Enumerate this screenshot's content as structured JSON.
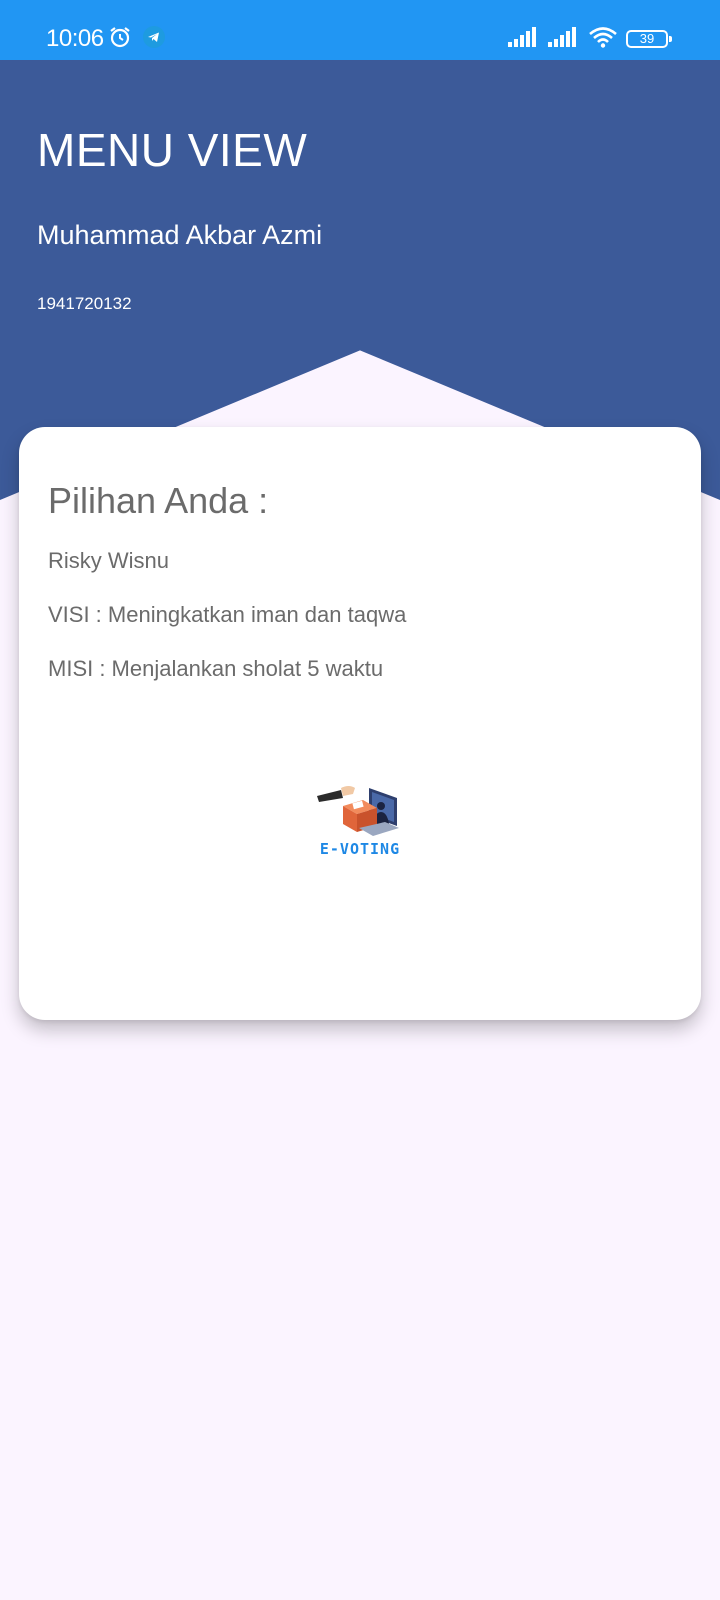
{
  "status_bar": {
    "time": "10:06",
    "battery": "39",
    "icons": [
      "alarm-icon",
      "telegram-icon",
      "signal-icon",
      "signal-icon",
      "wifi-icon",
      "battery-icon"
    ],
    "color": "#2196F3"
  },
  "header": {
    "title": "MENU VIEW",
    "name": "Muhammad Akbar Azmi",
    "id": "1941720132",
    "color": "#3C5A99"
  },
  "card": {
    "title": "Pilihan Anda :",
    "candidate": "Risky Wisnu",
    "visi": "VISI : Meningkatkan iman dan taqwa",
    "misi": "MISI : Menjalankan sholat 5 waktu",
    "logo_text": "E-VOTING"
  }
}
